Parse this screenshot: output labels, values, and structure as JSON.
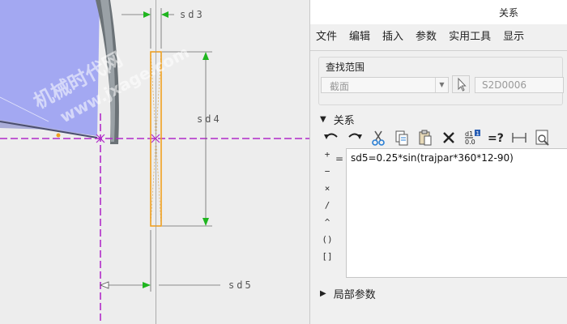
{
  "sketch": {
    "dimensions": {
      "sd3": "sd3",
      "sd4": "sd4",
      "sd5": "sd5"
    },
    "watermark": {
      "line1": "机械时代网",
      "line2": "www.jxage.com"
    }
  },
  "dialog": {
    "title": "关系",
    "menu": [
      "文件",
      "编辑",
      "插入",
      "参数",
      "实用工具",
      "显示"
    ],
    "scope": {
      "label": "查找范围",
      "select_value": "截面",
      "item_value": "S2D0006"
    },
    "relations_label": "关系",
    "toolbar": [
      "undo-icon",
      "redo-icon",
      "cut-icon",
      "copy-icon",
      "paste-icon",
      "delete-icon",
      "evaluate-icon",
      "verify-icon",
      "measure-icon",
      "sort-icon"
    ],
    "operators": [
      "+",
      "−",
      "×",
      "/",
      "^",
      "()",
      "[]"
    ],
    "relation_text": "sd5=0.25*sin(trajpar*360*12-90)",
    "local_params_label": "局部参数"
  },
  "colors": {
    "surface": "#a3a8f2",
    "centerline": "#b12bc9",
    "section": "#f0a020",
    "dimension": "#1fb51f"
  }
}
